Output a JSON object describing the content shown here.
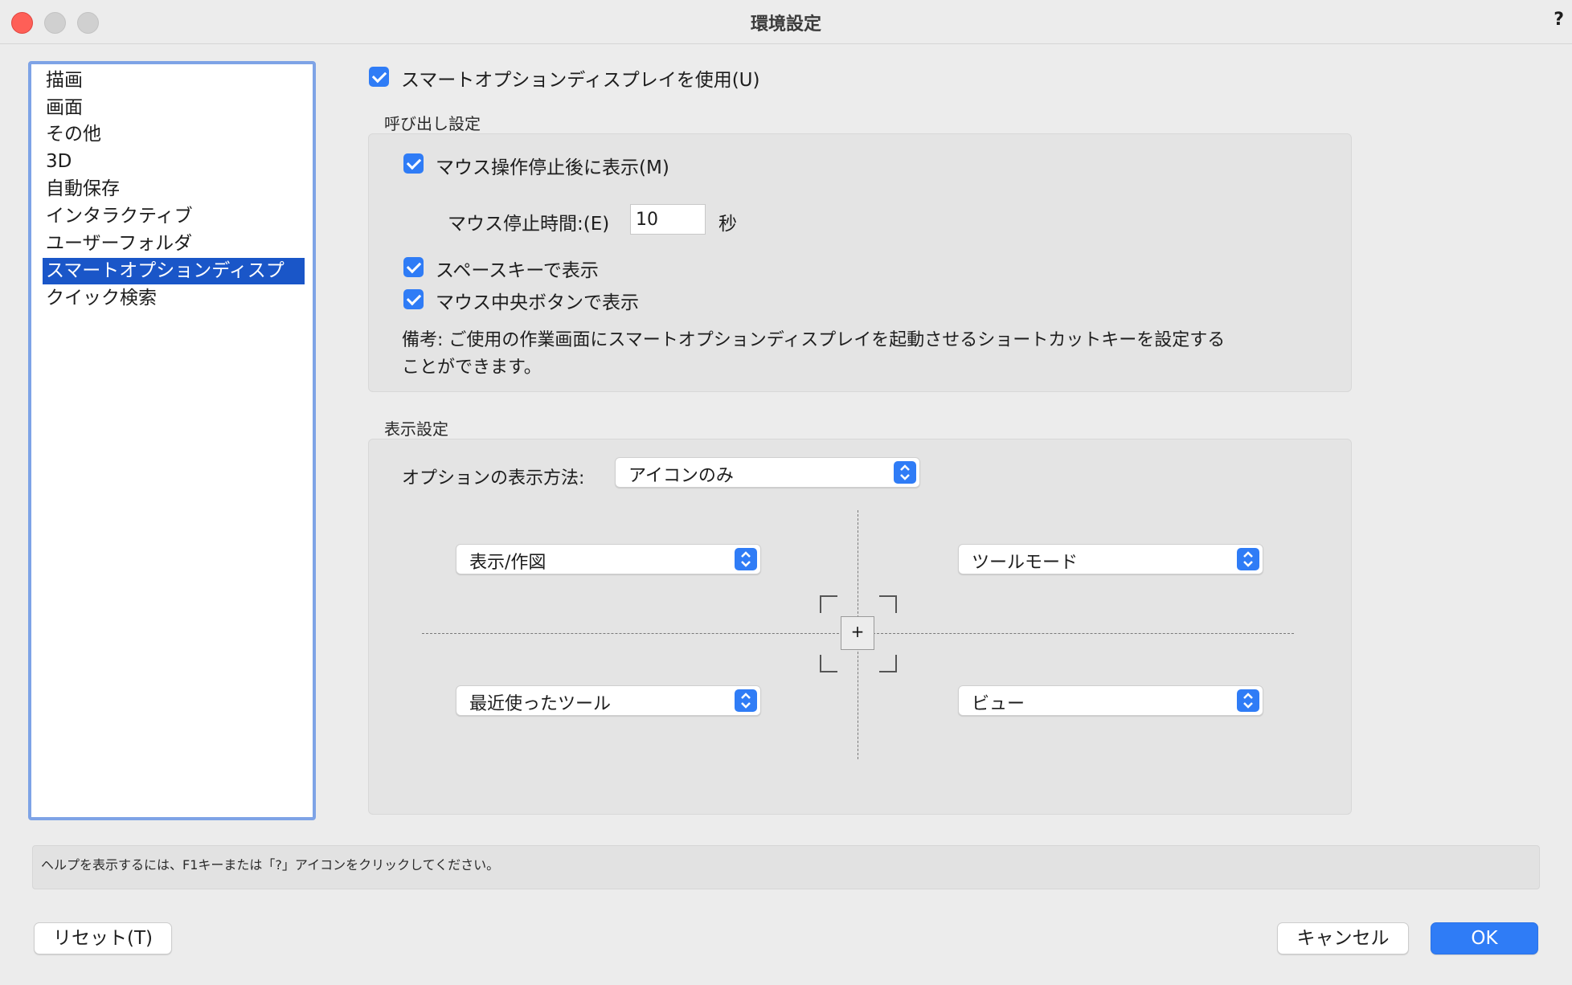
{
  "window": {
    "title": "環境設定",
    "help_icon": "?"
  },
  "sidebar": {
    "items": [
      {
        "label": "描画",
        "selected": false
      },
      {
        "label": "画面",
        "selected": false
      },
      {
        "label": "その他",
        "selected": false
      },
      {
        "label": "3D",
        "selected": false
      },
      {
        "label": "自動保存",
        "selected": false
      },
      {
        "label": "インタラクティブ",
        "selected": false
      },
      {
        "label": "ユーザーフォルダ",
        "selected": false
      },
      {
        "label": "スマートオプションディスプ",
        "selected": true
      },
      {
        "label": "クイック検索",
        "selected": false
      }
    ]
  },
  "main": {
    "use_smart_option": {
      "label": "スマートオプションディスプレイを使用(U)",
      "checked": true
    },
    "invoke": {
      "title": "呼び出し設定",
      "mouse_stop": {
        "label": "マウス操作停止後に表示(M)",
        "checked": true
      },
      "stop_time": {
        "label": "マウス停止時間:(E)",
        "value": "10",
        "unit": "秒"
      },
      "space_key": {
        "label": "スペースキーで表示",
        "checked": true
      },
      "middle_button": {
        "label": "マウス中央ボタンで表示",
        "checked": true
      },
      "note_line1": "備考: ご使用の作業画面にスマートオプションディスプレイを起動させるショートカットキーを設定する",
      "note_line2": "ことができます。"
    },
    "display": {
      "title": "表示設定",
      "method_label": "オプションの表示方法:",
      "method_value": "アイコンのみ",
      "top_left": "表示/作図",
      "top_right": "ツールモード",
      "bottom_left": "最近使ったツール",
      "bottom_right": "ビュー",
      "center_symbol": "+"
    }
  },
  "helpbar": {
    "text": "ヘルプを表示するには、F1キーまたは「?」アイコンをクリックしてください。"
  },
  "footer": {
    "reset": "リセット(T)",
    "cancel": "キャンセル",
    "ok": "OK"
  },
  "colors": {
    "accent": "#2f7cf6",
    "selection": "#1a56c8",
    "sidebar_border": "#7ea3e6"
  }
}
